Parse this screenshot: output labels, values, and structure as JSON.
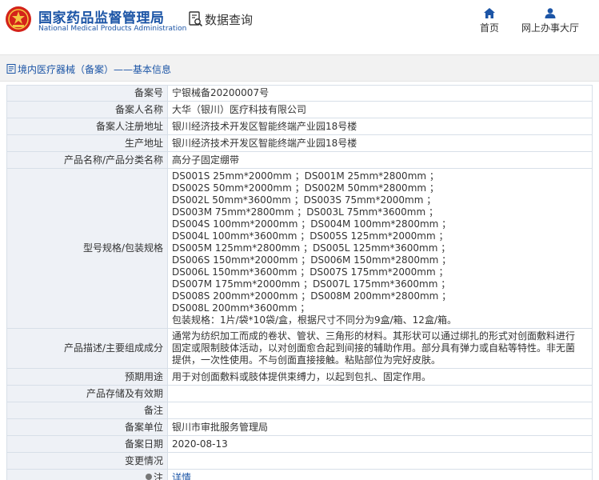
{
  "header": {
    "org_name_cn": "国家药品监督管理局",
    "org_name_en": "National Medical Products Administration",
    "db_title": "数据查询",
    "nav": [
      {
        "label": "首页",
        "icon": "home-icon"
      },
      {
        "label": "网上办事大厅",
        "icon": "user-icon"
      }
    ]
  },
  "breadcrumb": {
    "text": "境内医疗器械（备案）——基本信息"
  },
  "record": {
    "rows": [
      {
        "key": "备案号",
        "value": "宁银械备20200007号"
      },
      {
        "key": "备案人名称",
        "value": "大华（银川）医疗科技有限公司"
      },
      {
        "key": "备案人注册地址",
        "value": "银川经济技术开发区智能终端产业园18号楼"
      },
      {
        "key": "生产地址",
        "value": "银川经济技术开发区智能终端产业园18号楼"
      },
      {
        "key": "产品名称/产品分类名称",
        "value": "高分子固定绷带"
      },
      {
        "key": "型号规格/包装规格",
        "lines": [
          "DS001S 25mm*2000mm ；DS001M 25mm*2800mm ；",
          "DS002S 50mm*2000mm ；DS002M 50mm*2800mm ；",
          "DS002L 50mm*3600mm ；DS003S 75mm*2000mm ；",
          "DS003M 75mm*2800mm ；DS003L 75mm*3600mm ；",
          "DS004S 100mm*2000mm ；DS004M 100mm*2800mm ；",
          "DS004L 100mm*3600mm ；DS005S 125mm*2000mm ；",
          "DS005M 125mm*2800mm ；DS005L 125mm*3600mm ；",
          "DS006S 150mm*2000mm ；DS006M 150mm*2800mm ；",
          "DS006L 150mm*3600mm ；DS007S 175mm*2000mm ；",
          "DS007M 175mm*2000mm ；DS007L 175mm*3600mm ；",
          "DS008S 200mm*2000mm ；DS008M 200mm*2800mm ；",
          "DS008L 200mm*3600mm ；",
          "包装规格：1片/袋*10袋/盒，根据尺寸不同分为9盒/箱、12盒/箱。"
        ]
      },
      {
        "key": "产品描述/主要组成成分",
        "lines": [
          "通常为纺织加工而成的卷状、管状、三角形的材料。其形状可以通过绑扎的形式对创面敷料进行",
          "固定或限制肢体活动，以对创面愈合起到间接的辅助作用。部分具有弹力或自粘等特性。非无菌",
          "提供，一次性使用。不与创面直接接触。粘贴部位为完好皮肤。"
        ]
      },
      {
        "key": "预期用途",
        "value": "用于对创面敷料或肢体提供束缚力，以起到包扎、固定作用。"
      },
      {
        "key": "产品存储及有效期",
        "value": ""
      },
      {
        "key": "备注",
        "value": ""
      },
      {
        "key": "备案单位",
        "value": "银川市审批服务管理局"
      },
      {
        "key": "备案日期",
        "value": "2020-08-13"
      },
      {
        "key": "变更情况",
        "value": ""
      },
      {
        "key": "注",
        "value": "详情",
        "icon": "pin-icon"
      }
    ]
  },
  "colors": {
    "brand_blue": "#1c55a6",
    "key_cell_bg": "#eef1f6",
    "border": "#d7dfe8"
  }
}
